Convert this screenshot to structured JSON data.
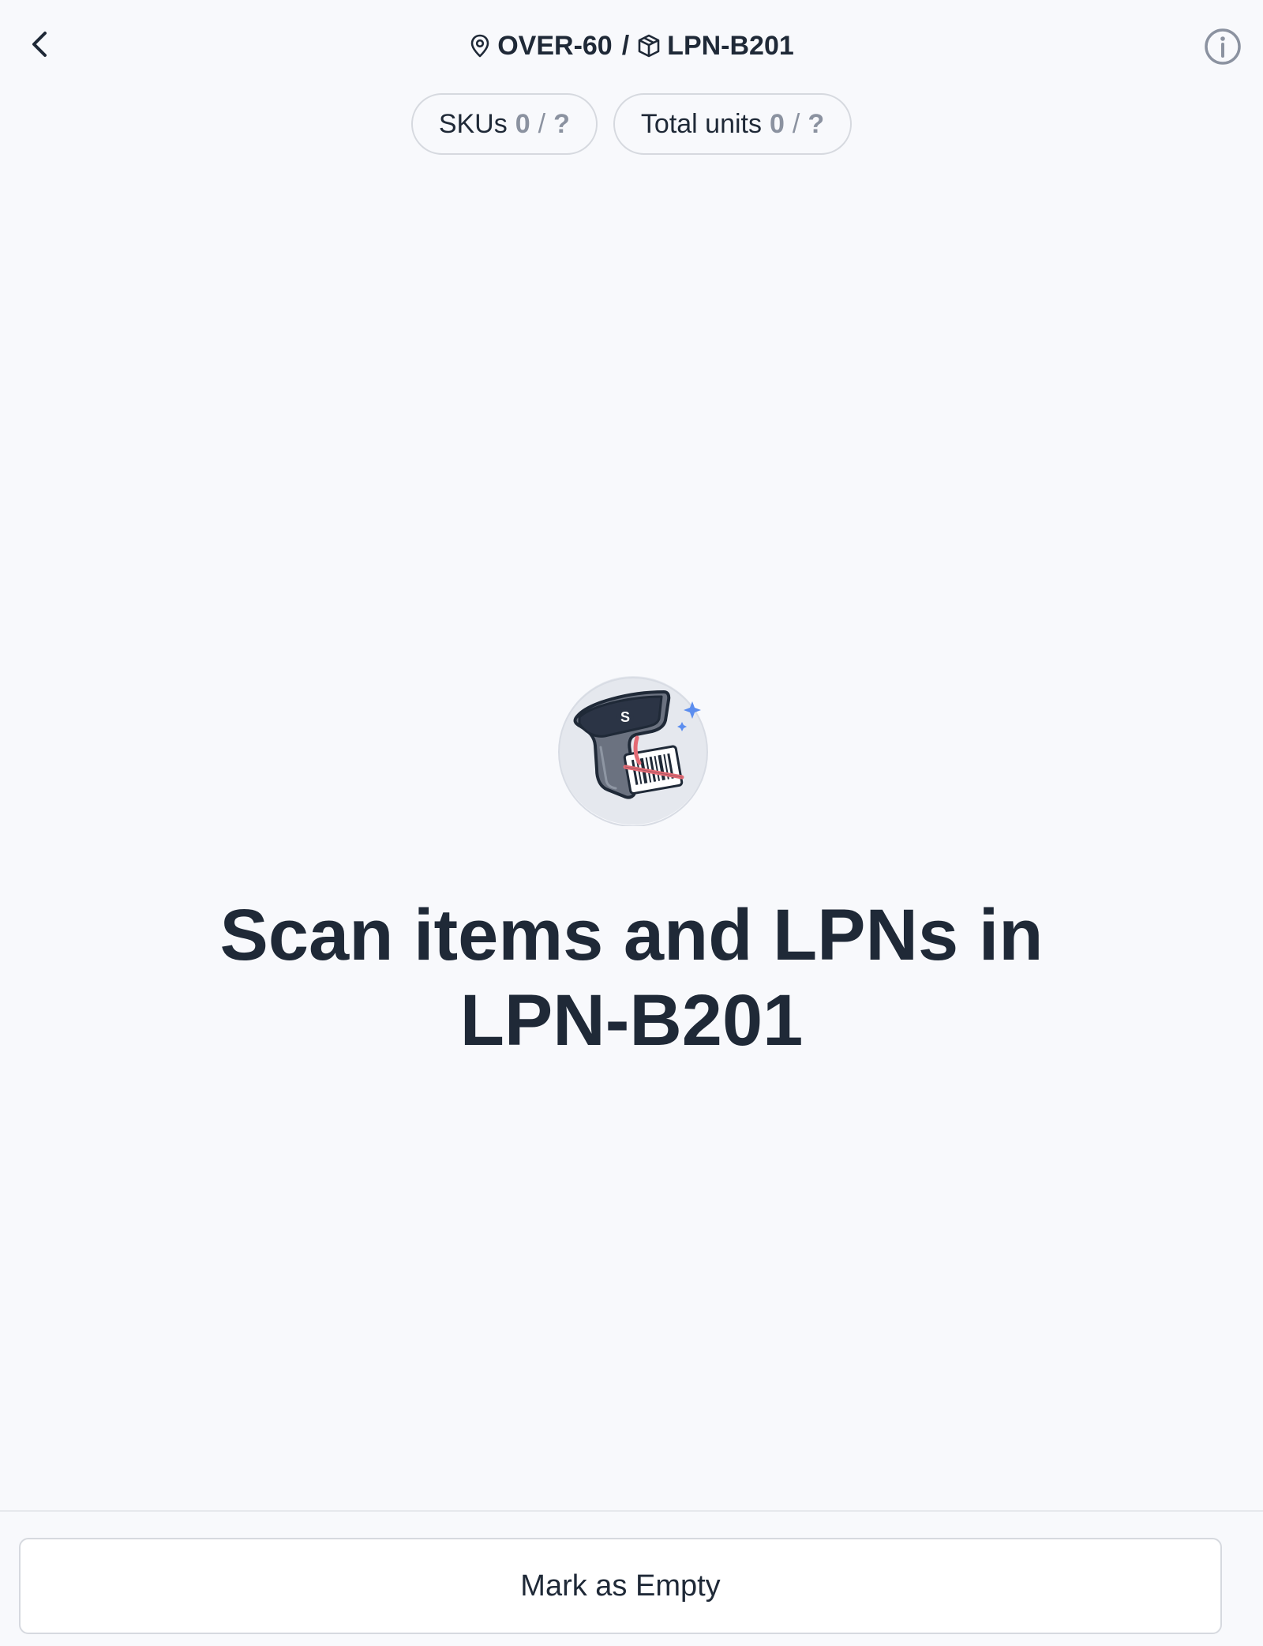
{
  "header": {
    "location_label": "OVER-60",
    "separator": "/",
    "lpn_label": "LPN-B201",
    "back_icon": "chevron-left-icon",
    "info_icon": "info-circle-icon",
    "location_icon": "map-pin-icon",
    "lpn_icon": "box-icon"
  },
  "counters": {
    "skus": {
      "label": "SKUs",
      "scanned": "0",
      "slash": "/",
      "expected": "?"
    },
    "units": {
      "label": "Total units",
      "scanned": "0",
      "slash": "/",
      "expected": "?"
    }
  },
  "main": {
    "illustration_icon": "barcode-scanner-icon",
    "headline_line1": "Scan items and LPNs in",
    "headline_line2": "LPN-B201"
  },
  "footer": {
    "mark_empty_label": "Mark as Empty"
  },
  "colors": {
    "background": "#f8f9fc",
    "text": "#1f2937",
    "muted": "#8b92a0",
    "border": "#d6d9df",
    "accent": "#5b8def"
  }
}
